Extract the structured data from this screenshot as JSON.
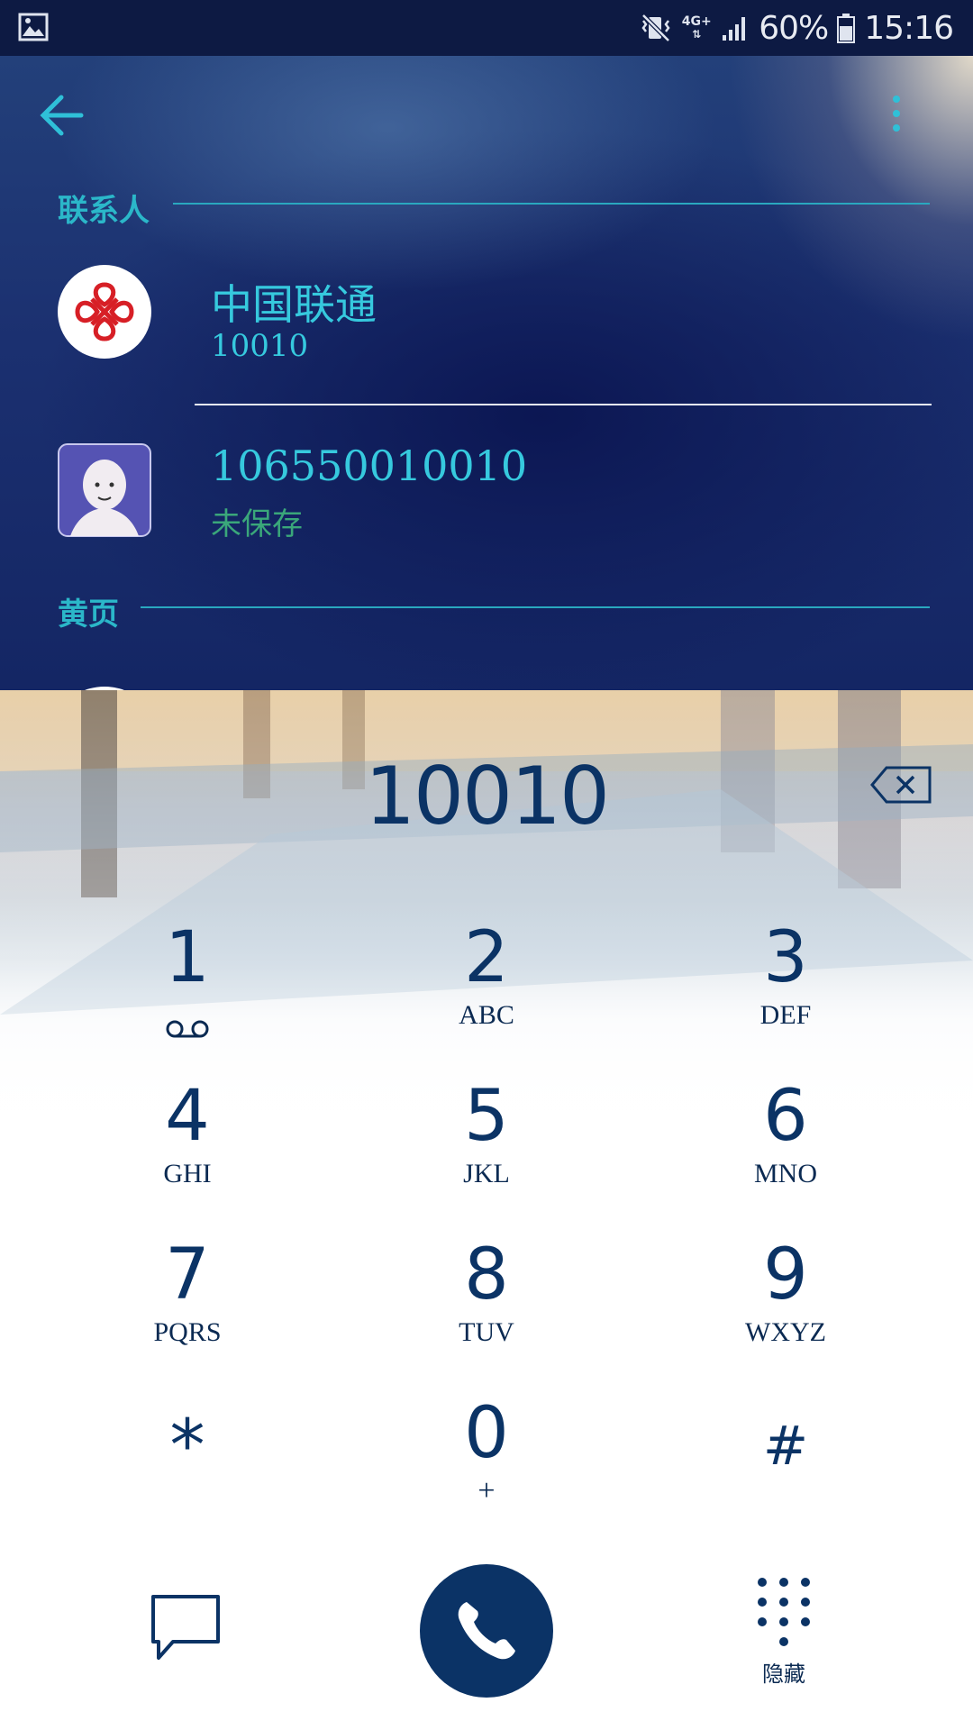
{
  "status_bar": {
    "network_type": "4G+",
    "battery_percent": "60%",
    "time": "15:16",
    "icons": [
      "gallery-notification-icon",
      "mute-vibrate-icon",
      "signal-icon",
      "battery-icon"
    ]
  },
  "contacts_panel": {
    "section_contacts": "联系人",
    "section_yellow_pages": "黄页",
    "contacts": [
      {
        "name": "中国联通",
        "number": "10010",
        "avatar": "china-unicom-logo"
      },
      {
        "name": "106550010010",
        "number": "未保存",
        "avatar": "default-person-avatar"
      }
    ]
  },
  "dialer": {
    "typed_number": "10010",
    "keys": [
      {
        "digit": "1",
        "letters": "",
        "extra_icon": "voicemail-icon"
      },
      {
        "digit": "2",
        "letters": "ABC"
      },
      {
        "digit": "3",
        "letters": "DEF"
      },
      {
        "digit": "4",
        "letters": "GHI"
      },
      {
        "digit": "5",
        "letters": "JKL"
      },
      {
        "digit": "6",
        "letters": "MNO"
      },
      {
        "digit": "7",
        "letters": "PQRS"
      },
      {
        "digit": "8",
        "letters": "TUV"
      },
      {
        "digit": "9",
        "letters": "WXYZ"
      },
      {
        "digit": "*",
        "letters": ""
      },
      {
        "digit": "0",
        "letters": "+"
      },
      {
        "digit": "#",
        "letters": ""
      }
    ],
    "hide_label": "隐藏"
  },
  "colors": {
    "accent_cyan": "#36c9de",
    "unsaved_green": "#3aa77a",
    "dial_blue": "#0b3365",
    "header_cyan": "#2bb7c9"
  }
}
